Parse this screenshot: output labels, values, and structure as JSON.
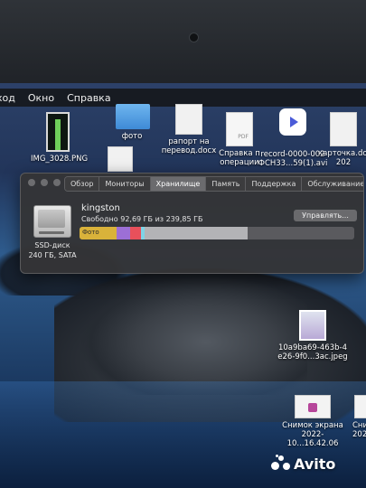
{
  "menubar": {
    "items": [
      "ход",
      "Окно",
      "Справка"
    ]
  },
  "desktop": {
    "files": [
      {
        "name": "IMG_3028.PNG",
        "icon": "image-file-icon"
      },
      {
        "name": "фото",
        "icon": "folder-icon"
      },
      {
        "name": "рапорт на\nперевод.docx",
        "icon": "document-icon"
      },
      {
        "name": "Справка п\nоперации",
        "icon": "pdf-icon"
      },
      {
        "name": "record-0000-002\nФСН33...59(1).avi",
        "icon": "video-app-icon"
      },
      {
        "name": "карточка.doc\n202",
        "icon": "document-icon"
      },
      {
        "name": "10a9ba69-463b-4\ne26-9f0...3ac.jpeg",
        "icon": "image-file-icon"
      },
      {
        "name": "Снимок экрана\n2022-10...16.42.06",
        "icon": "screenshot-icon"
      },
      {
        "name": "Сни\n2022",
        "icon": "screenshot-icon"
      }
    ]
  },
  "window": {
    "tabs": [
      {
        "label": "Обзор",
        "active": false
      },
      {
        "label": "Мониторы",
        "active": false
      },
      {
        "label": "Хранилище",
        "active": true
      },
      {
        "label": "Память",
        "active": false
      },
      {
        "label": "Поддержка",
        "active": false
      },
      {
        "label": "Обслуживание",
        "active": false
      }
    ],
    "disk": {
      "type": "SSD-диск",
      "capacity": "240 ГБ, SATA"
    },
    "volume": {
      "name": "kingston",
      "free_text": "Свободно 92,69 ГБ из 239,85 ГБ",
      "manage_label": "Управлять...",
      "free_gb": 92.69,
      "total_gb": 239.85
    },
    "storage_bar": {
      "hover_label": "Фото",
      "segments": [
        {
          "name": "Фото",
          "fraction": 0.135,
          "color": "#d9b23a"
        },
        {
          "name": "",
          "fraction": 0.05,
          "color": "#9c6fd6"
        },
        {
          "name": "",
          "fraction": 0.04,
          "color": "#e8505b"
        },
        {
          "name": "",
          "fraction": 0.012,
          "color": "#7fd3e6"
        },
        {
          "name": "",
          "fraction": 0.375,
          "color": "#b3b3b6"
        }
      ]
    }
  },
  "watermark": {
    "text": "Avito"
  }
}
